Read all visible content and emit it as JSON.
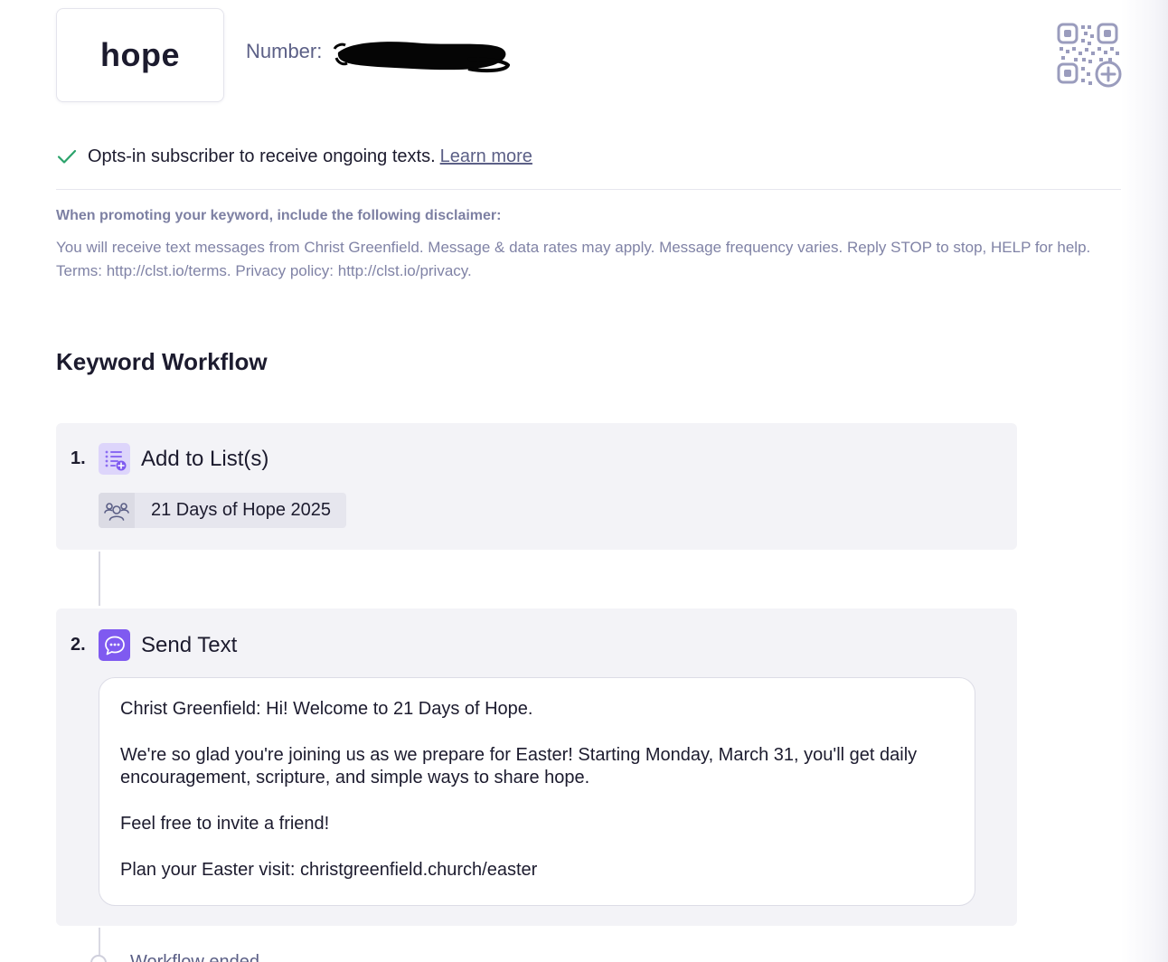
{
  "keyword": {
    "name": "hope"
  },
  "number": {
    "label": "Number:"
  },
  "optin": {
    "text": "Opts-in subscriber to receive ongoing texts.",
    "link": "Learn more"
  },
  "disclaimer": {
    "label": "When promoting your keyword, include the following disclaimer:",
    "text": "You will receive text messages from Christ Greenfield. Message & data rates may apply. Message frequency varies. Reply STOP to stop, HELP for help. Terms: http://clst.io/terms. Privacy policy: http://clst.io/privacy."
  },
  "workflow": {
    "title": "Keyword Workflow",
    "steps": [
      {
        "number": "1.",
        "title": "Add to List(s)",
        "icon": "list-add-icon",
        "list_name": "21 Days of Hope 2025"
      },
      {
        "number": "2.",
        "title": "Send Text",
        "icon": "chat-bubble-icon",
        "message": [
          "Christ Greenfield: Hi! Welcome to 21 Days of Hope.",
          "We're so glad you're joining us as we prepare for Easter! Starting Monday, March 31, you'll get daily encouragement, scripture, and simple ways to share hope.",
          "Feel free to invite a friend!",
          "Plan your Easter visit: christgreenfield.church/easter"
        ]
      }
    ],
    "end_label": "Workflow ended"
  },
  "colors": {
    "accent": "#7f5af0",
    "accent_light": "#ddd5fb",
    "success": "#2ba36b",
    "muted_text": "#8083a6",
    "step_bg": "#f3f3f7"
  }
}
